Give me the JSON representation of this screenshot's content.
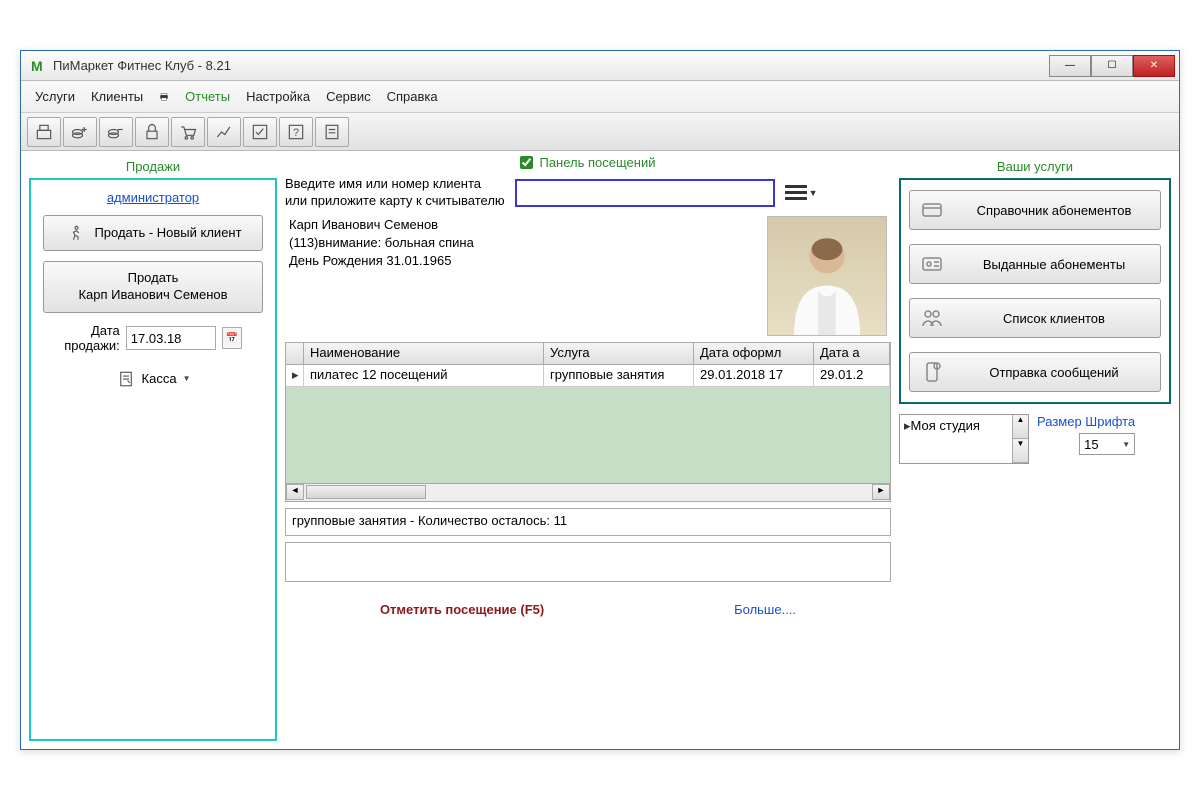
{
  "titlebar": {
    "app_icon": "M",
    "title": "ПиМаркет Фитнес Клуб - 8.21"
  },
  "menubar": {
    "items": [
      "Услуги",
      "Клиенты"
    ],
    "reports": "Отчеты",
    "rest": [
      "Настройка",
      "Сервис",
      "Справка"
    ]
  },
  "section_labels": {
    "sales": "Продажи",
    "visits_panel": "Панель посещений",
    "your_services": "Ваши услуги"
  },
  "left": {
    "admin_link": "администратор",
    "sell_new": "Продать - Новый клиент",
    "sell_client_l1": "Продать",
    "sell_client_l2": "Карп Иванович Семенов",
    "date_label_l1": "Дата",
    "date_label_l2": "продажи:",
    "date_value": "17.03.18",
    "kassa": "Касса"
  },
  "center": {
    "search_label_l1": "Введите имя или номер клиента",
    "search_label_l2": "или приложите карту к считывателю",
    "search_value": "",
    "client_name": "Карп Иванович Семенов",
    "client_note": "(113)внимание: больная спина",
    "client_bday": "День Рождения 31.01.1965",
    "grid_headers": {
      "name": "Наименование",
      "service": "Услуга",
      "date_reg": "Дата оформл",
      "date_act": "Дата а"
    },
    "grid_row": {
      "marker": "▸",
      "name": "пилатес 12 посещений",
      "service": "групповые занятия",
      "date_reg": "29.01.2018 17",
      "date_act": "29.01.2"
    },
    "status": "групповые занятия - Количество осталось: 11",
    "mark_visit": "Отметить посещение (F5)",
    "more": "Больше...."
  },
  "right": {
    "btn1": "Справочник абонементов",
    "btn2": "Выданные абонементы",
    "btn3": "Список клиентов",
    "btn4": "Отправка сообщений",
    "studio": "Моя студия",
    "font_label": "Размер Шрифта",
    "font_value": "15"
  }
}
